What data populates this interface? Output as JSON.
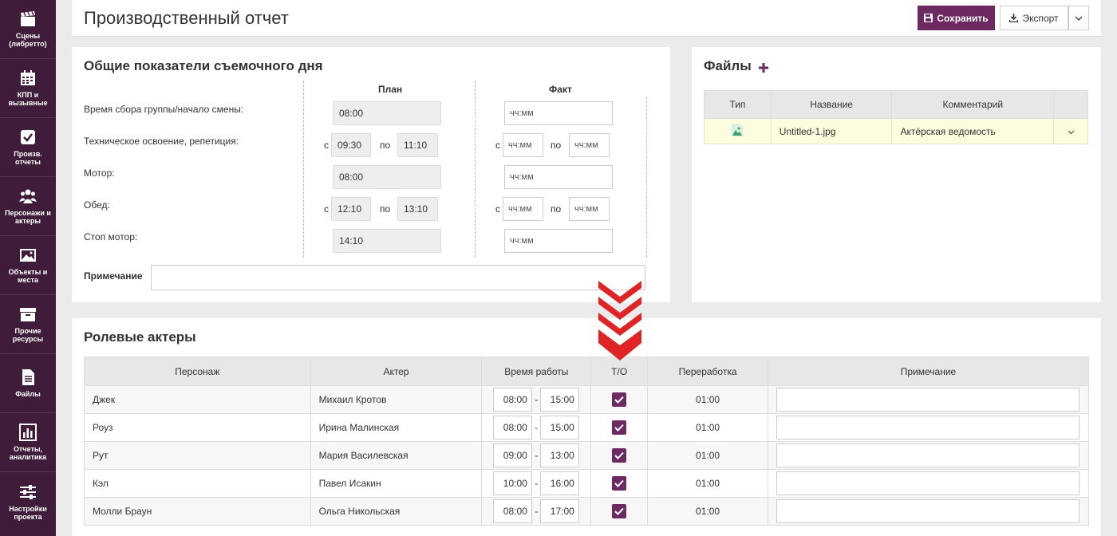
{
  "sidebar": {
    "items": [
      {
        "label": "Сцены\n(либретто)",
        "icon": "clapperboard-icon"
      },
      {
        "label": "КПП и\nвызывные",
        "icon": "calendar-icon"
      },
      {
        "label": "Произв.\nотчеты",
        "icon": "checkbox-icon"
      },
      {
        "label": "Персонажи и\nактеры",
        "icon": "people-icon"
      },
      {
        "label": "Объекты и\nместа",
        "icon": "image-icon"
      },
      {
        "label": "Прочие\nресурсы",
        "icon": "archive-icon"
      },
      {
        "label": "Файлы",
        "icon": "document-icon"
      },
      {
        "label": "Отчеты,\nаналитика",
        "icon": "bar-chart-icon"
      },
      {
        "label": "Настройки\nпроекта",
        "icon": "sliders-icon"
      }
    ]
  },
  "header": {
    "title": "Производственный отчет",
    "save_label": "Сохранить",
    "export_label": "Экспорт"
  },
  "indicators": {
    "title": "Общие показатели съемочного дня",
    "plan_header": "План",
    "fact_header": "Факт",
    "from_label": "с",
    "to_label": "по",
    "time_placeholder": "чч:мм",
    "rows": [
      {
        "label": "Время сбора группы/начало смены:",
        "plan": "08:00"
      },
      {
        "label": "Техническое освоение, репетиция:",
        "plan_from": "09:30",
        "plan_to": "11:10"
      },
      {
        "label": "Мотор:",
        "plan": "08:00"
      },
      {
        "label": "Обед:",
        "plan_from": "12:10",
        "plan_to": "13:10"
      },
      {
        "label": "Стоп мотор:",
        "plan": "14:10"
      }
    ],
    "note_label": "Примечание"
  },
  "files": {
    "title": "Файлы",
    "columns": [
      "Тип",
      "Название",
      "Комментарий"
    ],
    "rows": [
      {
        "type_icon": "image-file-icon",
        "name": "Untitled-1.jpg",
        "comment": "Актёрская ведомость"
      }
    ]
  },
  "actors": {
    "title": "Ролевые актеры",
    "columns": [
      "Персонаж",
      "Актер",
      "Время работы",
      "Т/О",
      "Переработка",
      "Примечание"
    ],
    "rows": [
      {
        "character": "Джек",
        "actor": "Михаил Кротов",
        "from": "08:00",
        "to": "15:00",
        "to_checked": true,
        "overtime": "01:00"
      },
      {
        "character": "Роуз",
        "actor": "Ирина Малинская",
        "from": "08:00",
        "to": "15:00",
        "to_checked": true,
        "overtime": "01:00"
      },
      {
        "character": "Рут",
        "actor": "Мария Василевская",
        "from": "09:00",
        "to": "13:00",
        "to_checked": true,
        "overtime": "01:00"
      },
      {
        "character": "Кэл",
        "actor": "Павел Исакин",
        "from": "10:00",
        "to": "16:00",
        "to_checked": true,
        "overtime": "01:00"
      },
      {
        "character": "Молли Браун",
        "actor": "Ольга Никольская",
        "from": "08:00",
        "to": "17:00",
        "to_checked": true,
        "overtime": "01:00"
      }
    ]
  },
  "colors": {
    "sidebar_bg": "#3f1d3a",
    "accent": "#6d2a62",
    "overtime": "#d9534f",
    "arrow": "#e02424"
  }
}
